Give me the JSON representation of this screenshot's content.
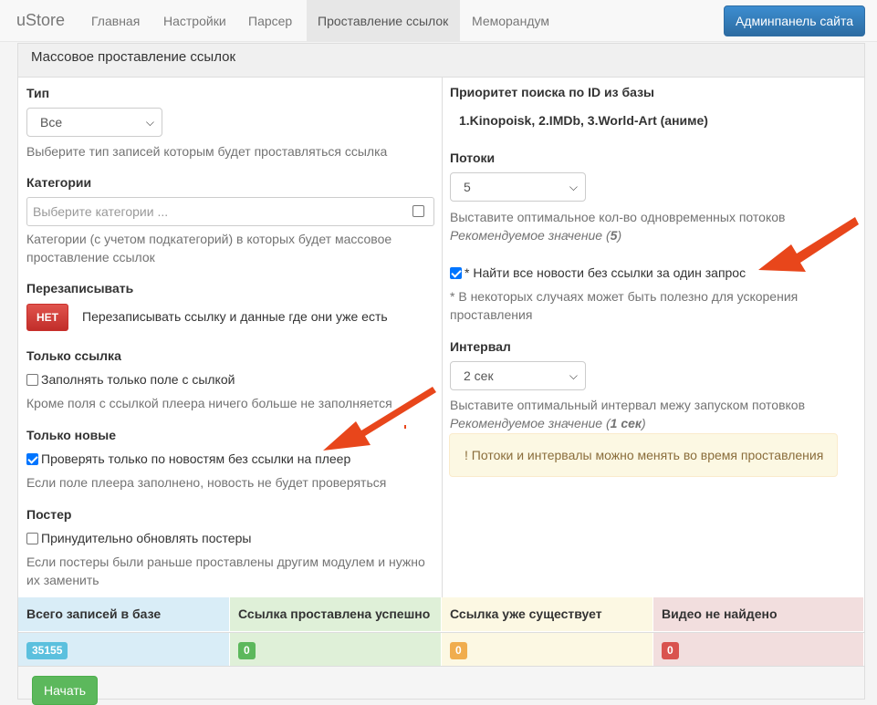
{
  "navbar": {
    "brand": "uStore",
    "items": [
      "Главная",
      "Настройки",
      "Парсер",
      "Проставление ссылок",
      "Меморандум"
    ],
    "active_index": 3,
    "admin_button": "Админпанель сайта"
  },
  "panel": {
    "title": "Массовое проставление ссылок"
  },
  "left": {
    "type": {
      "label": "Тип",
      "value": "Все",
      "help": "Выберите тип записей которым будет проставляться ссылка"
    },
    "categories": {
      "label": "Категории",
      "placeholder": "Выберите категории ...",
      "help": "Категории (с учетом подкатегорий) в которых будет массовое проставление ссылок"
    },
    "overwrite": {
      "label": "Перезаписывать",
      "button": "НЕТ",
      "text": "Перезаписывать ссылку и данные где они уже есть"
    },
    "link_only": {
      "label": "Только ссылка",
      "checkbox": "Заполнять только поле с сылкой",
      "checked": false,
      "help": "Кроме поля с ссылкой плеера ничего больше не заполняется"
    },
    "only_new": {
      "label": "Только новые",
      "checkbox": "Проверять только по новостям без ссылки на плеер",
      "checked": true,
      "help": "Если поле плеера заполнено, новость не будет проверяться"
    },
    "poster": {
      "label": "Постер",
      "checkbox": "Принудительно обновлять постеры",
      "checked": false,
      "help": "Если постеры были раньше проставлены другим модулем и нужно их заменить"
    }
  },
  "right": {
    "priority": {
      "label": "Приоритет поиска по ID из базы",
      "value": "1.Kinopoisk, 2.IMDb, 3.World-Art (аниме)"
    },
    "threads": {
      "label": "Потоки",
      "value": "5",
      "help": "Выставите оптимальное кол-во одновременных потоков",
      "recommend_prefix": "Рекомендуемое значение (",
      "recommend_value": "5",
      "recommend_suffix": ")"
    },
    "single_request": {
      "checkbox": "* Найти все новости без ссылки за один запрос",
      "checked": true,
      "help": "* В некоторых случаях может быть полезно для ускорения проставления"
    },
    "interval": {
      "label": "Интервал",
      "value": "2 сек",
      "help": "Выставите оптимальный интервал межу запуском потовков",
      "recommend_prefix": "Рекомендуемое значение (",
      "recommend_value": "1 сек",
      "recommend_suffix": ")"
    },
    "alert": "! Потоки и интервалы можно менять во время проставления"
  },
  "stats": {
    "columns": [
      {
        "header": "Всего записей в базе",
        "value": "35155",
        "bg": "#d9edf7",
        "badge": "#5bc0de"
      },
      {
        "header": "Ссылка проставлена успешно",
        "value": "0",
        "bg": "#dff0d8",
        "badge": "#5cb85c"
      },
      {
        "header": "Ссылка уже существует",
        "value": "0",
        "bg": "#fcf8e3",
        "badge": "#f0ad4e"
      },
      {
        "header": "Видео не найдено",
        "value": "0",
        "bg": "#f2dede",
        "badge": "#d9534f"
      }
    ]
  },
  "start_button": "Начать",
  "colors": {
    "arrow": "#e8461b",
    "primary": "#337ab7",
    "danger": "#d9534f"
  }
}
